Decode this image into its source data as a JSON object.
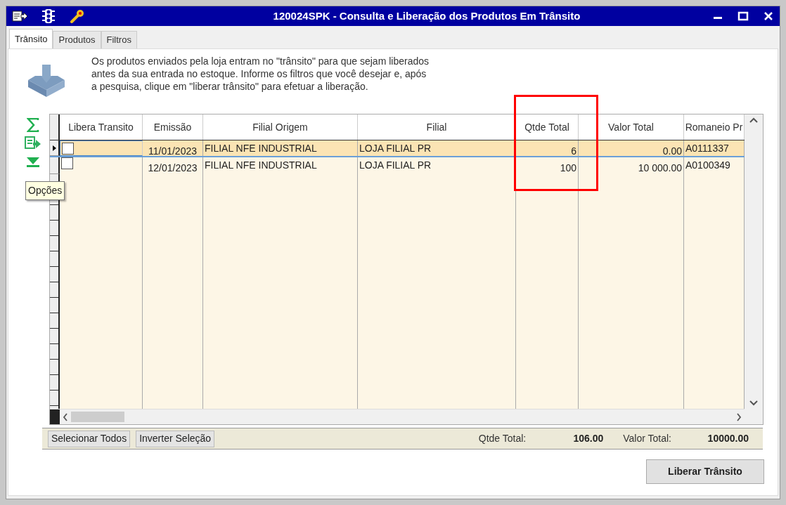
{
  "window": {
    "title": "120024SPK - Consulta e Liberação dos Produtos Em Trânsito"
  },
  "tabs": [
    {
      "label": "Trânsito",
      "selected": true
    },
    {
      "label": "Produtos",
      "selected": false
    },
    {
      "label": "Filtros",
      "selected": false
    }
  ],
  "info_lines": [
    "Os produtos enviados pela loja entram no \"trânsito\" para que sejam liberados",
    "antes da sua entrada no estoque. Informe os filtros que você desejar e, após",
    "a pesquisa, clique em \"liberar trânsito\" para efetuar a liberação."
  ],
  "tooltip": "Opções",
  "table": {
    "columns": [
      {
        "label": "Libera Transito",
        "highlighted": false
      },
      {
        "label": "Emissão",
        "highlighted": false
      },
      {
        "label": "Filial Origem",
        "highlighted": false
      },
      {
        "label": "Filial",
        "highlighted": false
      },
      {
        "label": "Qtde Total",
        "highlighted": true
      },
      {
        "label": "Valor Total",
        "highlighted": false
      },
      {
        "label": "Romaneio Pr",
        "highlighted": false
      }
    ],
    "rows": [
      {
        "selected": true,
        "checked": false,
        "cells": [
          "",
          "11/01/2023",
          "FILIAL NFE INDUSTRIAL",
          "LOJA FILIAL PR",
          "6",
          "0.00",
          "A0111337"
        ]
      },
      {
        "selected": false,
        "checked": false,
        "cells": [
          "",
          "12/01/2023",
          "FILIAL NFE INDUSTRIAL",
          "LOJA FILIAL PR",
          "100",
          "10 000.00",
          "A0100349"
        ]
      }
    ]
  },
  "footer": {
    "buttons": [
      "Selecionar Todos",
      "Inverter Seleção"
    ],
    "totals": [
      {
        "label": "Qtde Total:",
        "value": "106.00"
      },
      {
        "label": "Valor Total:",
        "value": "10000.00"
      }
    ]
  },
  "action_button": "Liberar Trânsito"
}
